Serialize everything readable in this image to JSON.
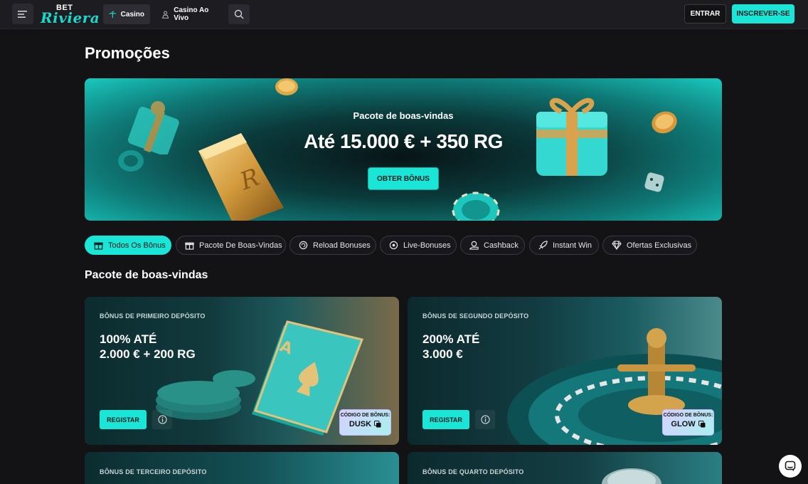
{
  "header": {
    "logo_top": "BET",
    "logo_main": "Riviera",
    "nav": [
      {
        "label": "Casino",
        "icon": "palm-tree-icon"
      },
      {
        "label": "Casino Ao Vivo",
        "icon": "dealer-icon"
      }
    ],
    "login_label": "ENTRAR",
    "signup_label": "INSCREVER-SE"
  },
  "page": {
    "title": "Promoções"
  },
  "hero": {
    "subtitle": "Pacote de boas-vindas",
    "title": "Até 15.000 € + 350 RG",
    "button": "OBTER BÔNUS"
  },
  "filters": [
    {
      "label": "Todos Os Bônus",
      "icon": "gift-icon",
      "active": true
    },
    {
      "label": "Pacote De Boas-Vindas",
      "icon": "gift-box-icon",
      "active": false
    },
    {
      "label": "Reload Bonuses",
      "icon": "reload-icon",
      "active": false
    },
    {
      "label": "Live-Bonuses",
      "icon": "live-icon",
      "active": false
    },
    {
      "label": "Cashback",
      "icon": "cashback-icon",
      "active": false
    },
    {
      "label": "Instant Win",
      "icon": "rocket-icon",
      "active": false
    },
    {
      "label": "Ofertas Exclusivas",
      "icon": "diamond-icon",
      "active": false
    }
  ],
  "section": {
    "title": "Pacote de boas-vindas",
    "cards": [
      {
        "label": "BÔNUS DE PRIMEIRO DEPÓSITO",
        "amount": "100% ATÉ\n2.000 € + 200 RG",
        "button": "REGISTAR",
        "code_label": "CÓDIGO DE BÔNUS:",
        "code": "DUSK"
      },
      {
        "label": "BÔNUS DE SEGUNDO DEPÓSITO",
        "amount": "200% ATÉ\n3.000 €",
        "button": "REGISTAR",
        "code_label": "CÓDIGO DE BÔNUS:",
        "code": "GLOW"
      },
      {
        "label": "BÔNUS DE TERCEIRO DEPÓSITO"
      },
      {
        "label": "BÔNUS DE QUARTO DEPÓSITO"
      }
    ]
  },
  "colors": {
    "accent": "#19e6d6",
    "background": "#131316",
    "header": "#1c1c21"
  }
}
